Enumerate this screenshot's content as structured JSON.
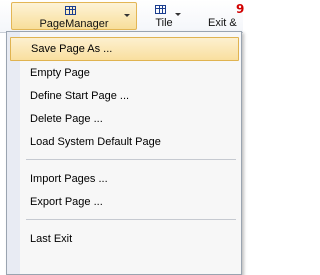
{
  "toolbar": {
    "page_manager_label": "PageManager",
    "tile_label": "Tile",
    "exit_label": "Exit &"
  },
  "menu": {
    "items": [
      {
        "label": "Save Page As ..."
      },
      {
        "label": "Empty Page"
      },
      {
        "label": "Define Start Page ..."
      },
      {
        "label": "Delete Page ..."
      },
      {
        "label": "Load System Default Page"
      },
      {
        "label": "Import Pages ..."
      },
      {
        "label": "Export Page ..."
      },
      {
        "label": "Last Exit"
      }
    ]
  },
  "icons": {
    "page_manager": "table-grid-icon",
    "tile": "table-grid-icon",
    "exit": "exit-icon"
  },
  "colors": {
    "highlight_fill": "#f9df9f",
    "highlight_border": "#e0b350",
    "icon_blue": "#1a3d8f",
    "exit_red": "#d10000"
  }
}
